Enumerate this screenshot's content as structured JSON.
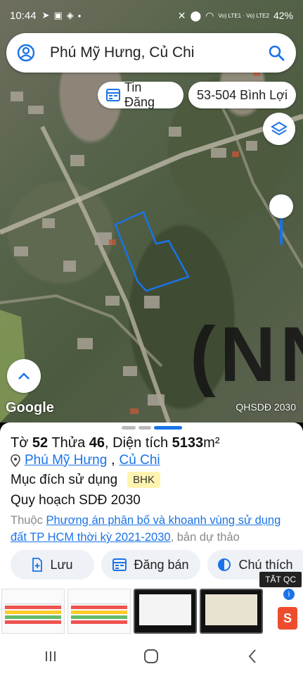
{
  "status_bar": {
    "time": "10:44",
    "battery": "42%",
    "network": "Vo) LTE1 · Vo) LTE2"
  },
  "search": {
    "query": "Phú Mỹ Hưng, Củ Chi"
  },
  "chips": {
    "tin_dang": "Tin Đăng",
    "address": "53-504 Bình Lợi"
  },
  "map": {
    "google_label": "Google",
    "plan_label": "QHSDĐ 2030",
    "watermark_text": "(NN",
    "parcel_outline_color": "#1a73e8"
  },
  "parcel": {
    "sheet_label": "Tờ",
    "sheet_no": "52",
    "lot_label": "Thửa",
    "lot_no": "46",
    "area_label": "Diện tích",
    "area_value": "5133",
    "area_unit": "m²",
    "ward": "Phú Mỹ Hưng",
    "district": "Củ Chi",
    "purpose_label": "Mục đích sử dụng",
    "purpose_code": "BHK",
    "plan_title": "Quy hoạch SDĐ 2030",
    "source_prefix": "Thuộc",
    "source_link": "Phương án phân bố và khoanh vùng sử dụng đất TP HCM thời kỳ 2021-2030",
    "source_suffix": ", bản dự thảo"
  },
  "actions": {
    "save": "Lưu",
    "post": "Đăng bán",
    "legend": "Chú thích"
  },
  "ad": {
    "close_label": "TẮT QC"
  },
  "colors": {
    "accent": "#1a73e8",
    "badge_bg": "#fff3b0"
  }
}
